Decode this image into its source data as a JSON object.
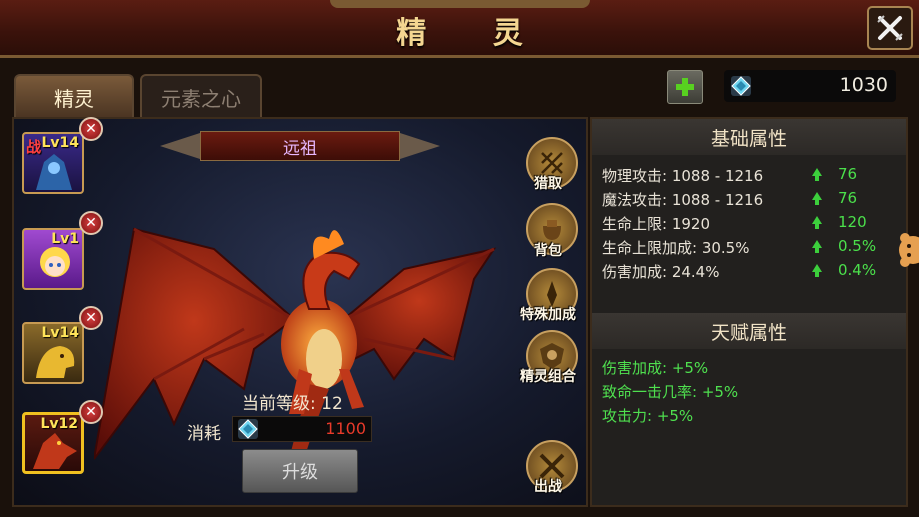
{
  "header": {
    "title": "精 灵"
  },
  "tabs": [
    {
      "label": "精灵",
      "active": true
    },
    {
      "label": "元素之心",
      "active": false
    }
  ],
  "currency": {
    "icon": "gem-icon",
    "value": "1030"
  },
  "sprite": {
    "name": "远祖",
    "level_label": "当前等级: 12"
  },
  "cost": {
    "label": "消耗",
    "value": "1100",
    "icon": "gem-icon"
  },
  "upgrade_button": {
    "label": "升级",
    "enabled": false
  },
  "slots": [
    {
      "level": "Lv14",
      "tag": "战",
      "selected": false
    },
    {
      "level": "Lv1",
      "tag": "",
      "selected": false
    },
    {
      "level": "Lv14",
      "tag": "",
      "selected": false
    },
    {
      "level": "Lv12",
      "tag": "",
      "selected": true
    }
  ],
  "side_buttons": [
    {
      "label": "猎取",
      "icon": "net-icon"
    },
    {
      "label": "背包",
      "icon": "bag-icon"
    },
    {
      "label": "特殊加成",
      "icon": "spear-icon"
    },
    {
      "label": "精灵组合",
      "icon": "crest-icon"
    },
    {
      "label": "出战",
      "icon": "crossed-swords-icon"
    }
  ],
  "base_attributes": {
    "title": "基础属性",
    "rows": [
      {
        "label": "物理攻击: 1088 - 1216",
        "increase": "76"
      },
      {
        "label": "魔法攻击: 1088 - 1216",
        "increase": "76"
      },
      {
        "label": "生命上限: 1920",
        "increase": "120"
      },
      {
        "label": "生命上限加成: 30.5%",
        "increase": "0.5%"
      },
      {
        "label": "伤害加成: 24.4%",
        "increase": "0.4%"
      }
    ]
  },
  "talent_attributes": {
    "title": "天赋属性",
    "rows": [
      "伤害加成: +5%",
      "致命一击几率: +5%",
      "攻击力: +5%"
    ]
  },
  "colors": {
    "accent": "#f4d691",
    "increase": "#4be04b",
    "cost": "#e83a2a",
    "selected_border": "#f0c020"
  }
}
